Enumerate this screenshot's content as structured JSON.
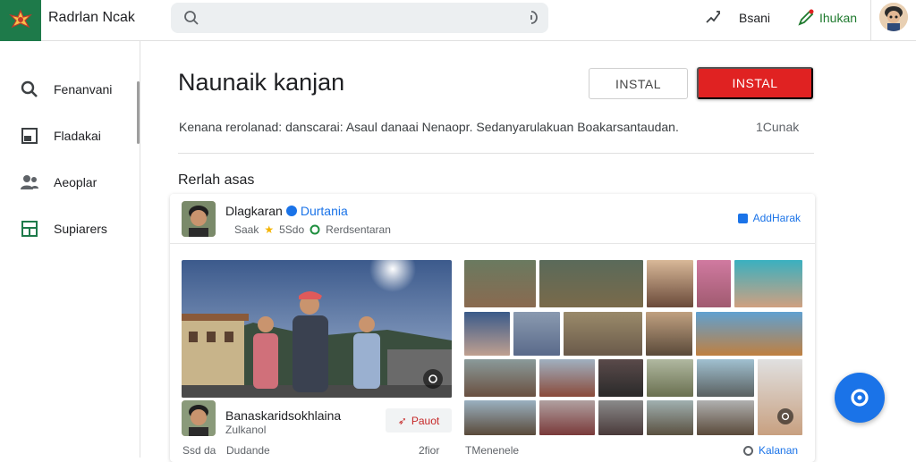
{
  "app": {
    "title": "Radrlan Nсak"
  },
  "header": {
    "search_placeholder": "",
    "action1_label": "Bsani",
    "action2_label": "Ihukan",
    "accent_green": "#1e7a2e"
  },
  "sidebar": {
    "items": [
      {
        "label": "Fenanvani",
        "icon": "search-icon"
      },
      {
        "label": "Fladakai",
        "icon": "inbox-icon"
      },
      {
        "label": "Aeoplar",
        "icon": "people-icon"
      },
      {
        "label": "Supiarers",
        "icon": "grid-icon"
      }
    ]
  },
  "main": {
    "title": "Naunaik kanjan",
    "btn_outline": "INSTAL",
    "btn_primary": "INSTAL",
    "primary_color": "#e02222",
    "description": "Kenana rerolanad: danscarai: Asaul danaai Nenaopr. Sedanyarulakuan Boakarsantaudan.",
    "description_right": "1Cunak",
    "section_title": "Rerlah asas"
  },
  "card": {
    "name": "Dlagkaran",
    "brand": "Durtania",
    "meta_rating": "Saak",
    "meta_count": "5Sdo",
    "meta_status": "Rerdsentaran",
    "action_label": "AddHarak",
    "sub_title": "Banaskaridsokhlaina",
    "sub_subtitle": "Zulkanol",
    "pill_label": "Pauot",
    "footer_left1": "Ssd da",
    "footer_left2": "Dudande",
    "footer_mid": "2fior",
    "footer_right1": "TMenenele",
    "footer_right2": "Kalanan"
  }
}
